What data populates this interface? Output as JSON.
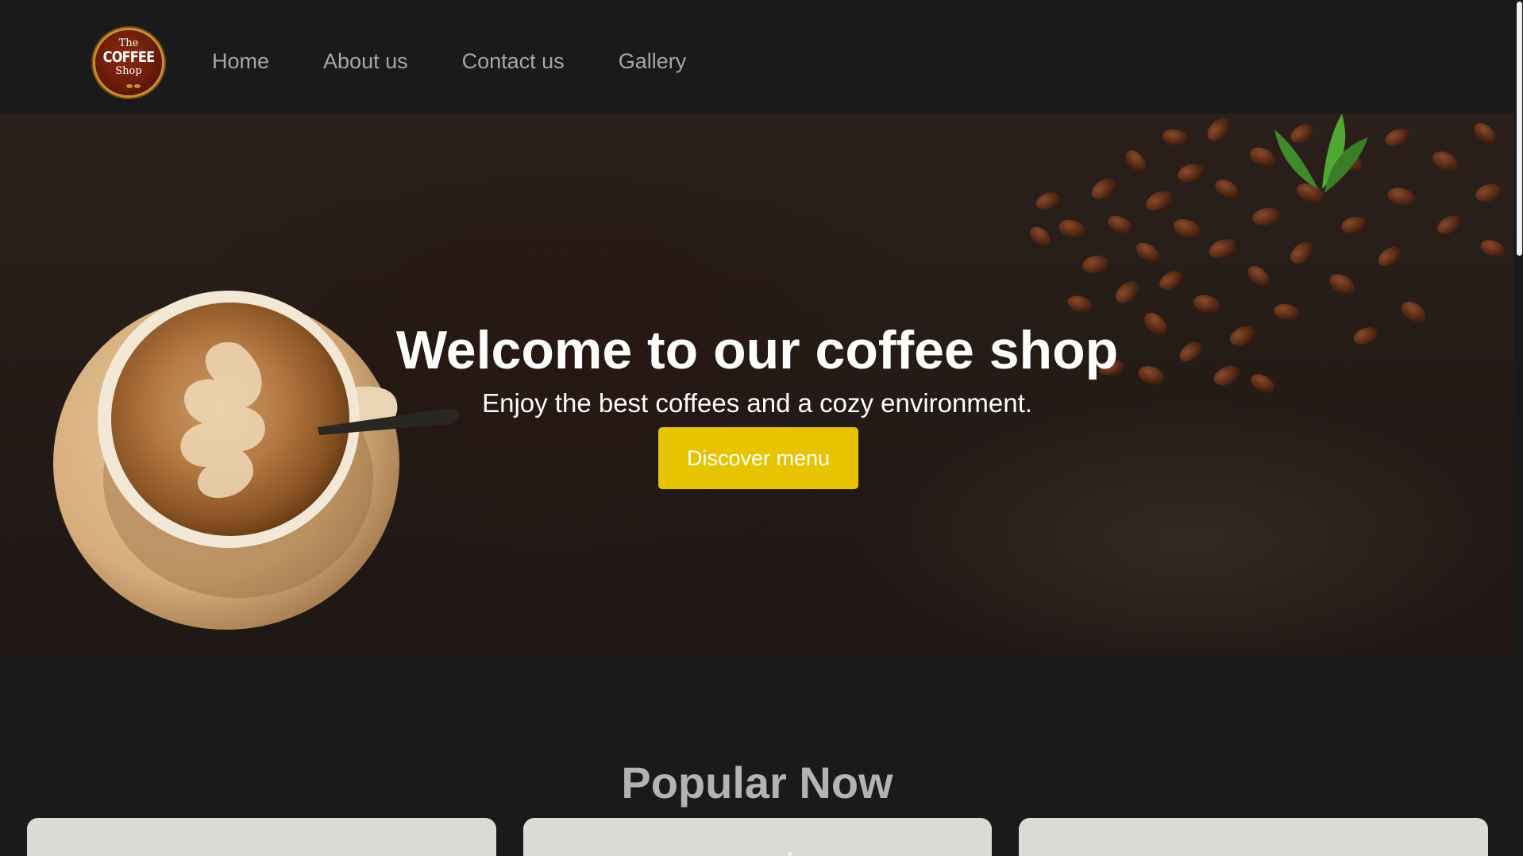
{
  "brand": {
    "logo_line1": "The",
    "logo_line2": "COFFEE",
    "logo_line3": "Shop"
  },
  "nav": {
    "items": [
      "Home",
      "About us",
      "Contact us",
      "Gallery"
    ]
  },
  "hero": {
    "title": "Welcome to our coffee shop",
    "subtitle": "Enjoy the best coffees and a cozy environment.",
    "button_label": "Discover menu"
  },
  "popular": {
    "title": "Popular Now"
  },
  "colors": {
    "background": "#1a1a1a",
    "accent_button": "#e8c400",
    "nav_text": "#a6a6a6",
    "card": "#dcdad6"
  }
}
